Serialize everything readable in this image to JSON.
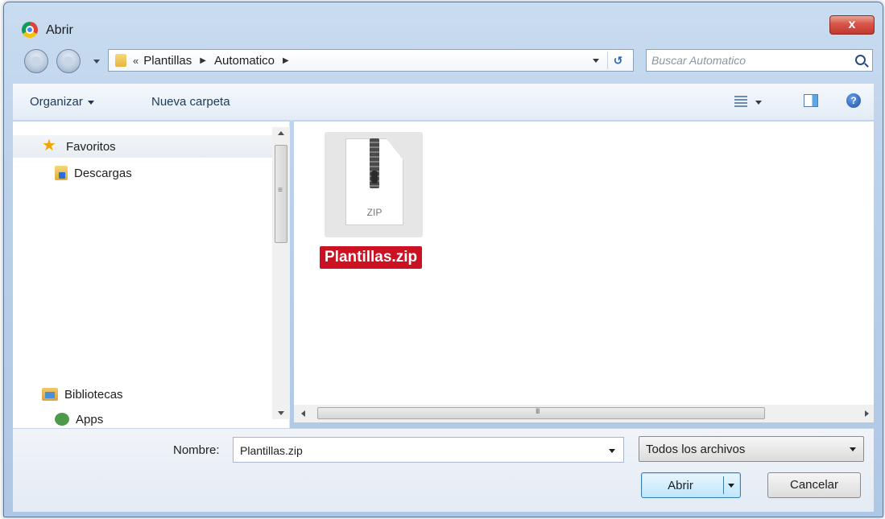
{
  "window": {
    "title": "Abrir",
    "close_label": "x"
  },
  "address": {
    "overflow_marker": "«",
    "crumbs": [
      "Plantillas",
      "Automatico"
    ],
    "refresh_glyph": "↺"
  },
  "search": {
    "placeholder": "Buscar Automatico"
  },
  "toolbar": {
    "organizar_label": "Organizar",
    "nueva_carpeta_label": "Nueva carpeta",
    "help_glyph": "?"
  },
  "nav": {
    "favoritos_label": "Favoritos",
    "descargas_label": "Descargas",
    "bibliotecas_label": "Bibliotecas",
    "apps_label": "Apps"
  },
  "files": [
    {
      "name": "Plantillas.zip",
      "type_label": "ZIP",
      "selected": true
    }
  ],
  "footer": {
    "nombre_label": "Nombre:",
    "nombre_value": "Plantillas.zip",
    "file_type_value": "Todos los archivos",
    "abrir_label": "Abrir",
    "cancelar_label": "Cancelar"
  },
  "colors": {
    "selection_highlight": "#cc1122",
    "titlebar": "#b9d0ea",
    "close_button": "#c23a2e"
  }
}
